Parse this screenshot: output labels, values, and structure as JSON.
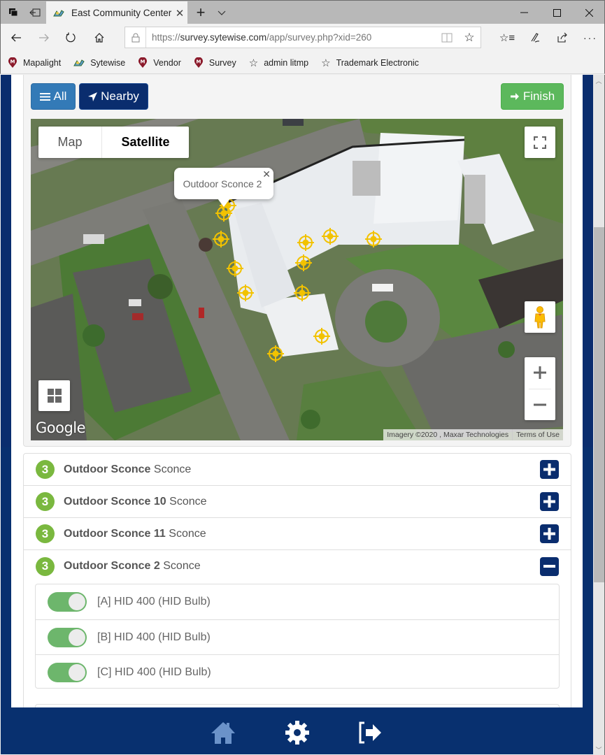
{
  "browser": {
    "tab_title": "East Community Center",
    "url_prefix": "https://",
    "url_host": "survey.sytewise.com",
    "url_path": "/app/survey.php?xid=260",
    "favorites": [
      {
        "label": "Mapalight",
        "icon": "mapalight-icon"
      },
      {
        "label": "Sytewise",
        "icon": "sytewise-icon"
      },
      {
        "label": "Vendor",
        "icon": "mapalight-icon"
      },
      {
        "label": "Survey",
        "icon": "mapalight-icon"
      },
      {
        "label": "admin litmp",
        "icon": "star-icon"
      },
      {
        "label": "Trademark Electronic",
        "icon": "star-icon"
      }
    ]
  },
  "toolbar": {
    "all_label": "All",
    "nearby_label": "Nearby",
    "finish_label": "Finish"
  },
  "map": {
    "type_map_label": "Map",
    "type_satellite_label": "Satellite",
    "selected_type": "Satellite",
    "infowindow_text": "Outdoor Sconce 2",
    "attribution": "Imagery ©2020 , Maxar Technologies",
    "terms_label": "Terms of Use",
    "logo_text": "Google",
    "marker_color": "#f2c200",
    "marker_count": 12
  },
  "fixtures": [
    {
      "count": "3",
      "name": "Outdoor Sconce",
      "type": "Sconce",
      "expanded": false
    },
    {
      "count": "3",
      "name": "Outdoor Sconce 10",
      "type": "Sconce",
      "expanded": false
    },
    {
      "count": "3",
      "name": "Outdoor Sconce 11",
      "type": "Sconce",
      "expanded": false
    },
    {
      "count": "3",
      "name": "Outdoor Sconce 2",
      "type": "Sconce",
      "expanded": true
    }
  ],
  "lamps": [
    {
      "label": "[A] HID 400 (HID Bulb)",
      "on": true
    },
    {
      "label": "[B] HID 400 (HID Bulb)",
      "on": true
    },
    {
      "label": "[C] HID 400 (HID Bulb)",
      "on": true
    }
  ],
  "colors": {
    "navy": "#0a2d6e",
    "primary": "#337ab7",
    "success": "#5cb85c",
    "badge_green": "#7ab83f",
    "switch_green": "#6db66c"
  }
}
